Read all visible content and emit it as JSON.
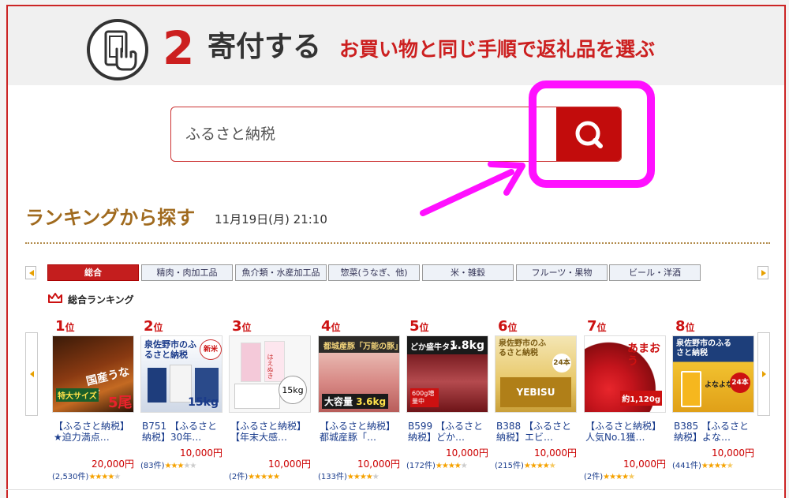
{
  "header": {
    "step_number": "2",
    "step_title": "寄付する",
    "step_subtitle": "お買い物と同じ手順で返礼品を選ぶ",
    "step_icon": "smartphone-tap-icon"
  },
  "search": {
    "query": "ふるさと納税",
    "button_icon": "search-icon"
  },
  "ranking": {
    "title": "ランキングから探す",
    "date": "11月19日(月) 21:10",
    "section_label": "総合ランキング"
  },
  "tabs": [
    "総合",
    "精肉・肉加工品",
    "魚介類・水産加工品",
    "惣菜(うなぎ、他)",
    "米・雑穀",
    "フルーツ・果物",
    "ビール・洋酒"
  ],
  "colors": {
    "accent": "#cc1f1f",
    "highlight": "#ff10ff",
    "link": "#1a3c8c",
    "star": "#f5a200"
  },
  "products": [
    {
      "rank": "1",
      "rank_suffix": "位",
      "name": "【ふるさと納税】★迫力満点…",
      "price": "20,000円",
      "reviews": "(2,530件)",
      "rating": 4
    },
    {
      "rank": "2",
      "rank_suffix": "位",
      "name": "B751 【ふるさと納税】30年…",
      "price": "10,000円",
      "reviews": "(83件)",
      "rating": 3
    },
    {
      "rank": "3",
      "rank_suffix": "位",
      "name": "【ふるさと納税】【年末大感…",
      "price": "10,000円",
      "reviews": "(2件)",
      "rating": 5
    },
    {
      "rank": "4",
      "rank_suffix": "位",
      "name": "【ふるさと納税】都城産豚「…",
      "price": "10,000円",
      "reviews": "(133件)",
      "rating": 4
    },
    {
      "rank": "5",
      "rank_suffix": "位",
      "name": "B599 【ふるさと納税】どか…",
      "price": "10,000円",
      "reviews": "(172件)",
      "rating": 4
    },
    {
      "rank": "6",
      "rank_suffix": "位",
      "name": "B388 【ふるさと納税】エビ…",
      "price": "10,000円",
      "reviews": "(215件)",
      "rating": 4.5
    },
    {
      "rank": "7",
      "rank_suffix": "位",
      "name": "【ふるさと納税】人気No.1獲…",
      "price": "10,000円",
      "reviews": "(2件)",
      "rating": 4.5
    },
    {
      "rank": "8",
      "rank_suffix": "位",
      "name": "B385 【ふるさと納税】よな…",
      "price": "10,000円",
      "reviews": "(441件)",
      "rating": 4.5
    }
  ],
  "images": [
    {
      "label": "国産うなぎ",
      "text_a": "特大サイズ",
      "text_b": "5尾"
    },
    {
      "label": "泉佐野市のふるさと納税",
      "text_a": "新米",
      "text_b": "15kg"
    },
    {
      "label": "はえぬき",
      "text_a": "15kg",
      "text_b": ""
    },
    {
      "label": "都城産豚「万能の豚」",
      "text_a": "大容量",
      "text_b": "3.6kg"
    },
    {
      "label": "どか盛牛タン",
      "text_a": "1.8kg",
      "text_b": "600g増量中"
    },
    {
      "label": "泉佐野市のふるさと納税",
      "text_a": "YEBISU",
      "text_b": "24本"
    },
    {
      "label": "あまおう",
      "text_a": "約1,120g",
      "text_b": ""
    },
    {
      "label": "泉佐野市のふるさと納税",
      "text_a": "よなよな",
      "text_b": "24本"
    }
  ]
}
